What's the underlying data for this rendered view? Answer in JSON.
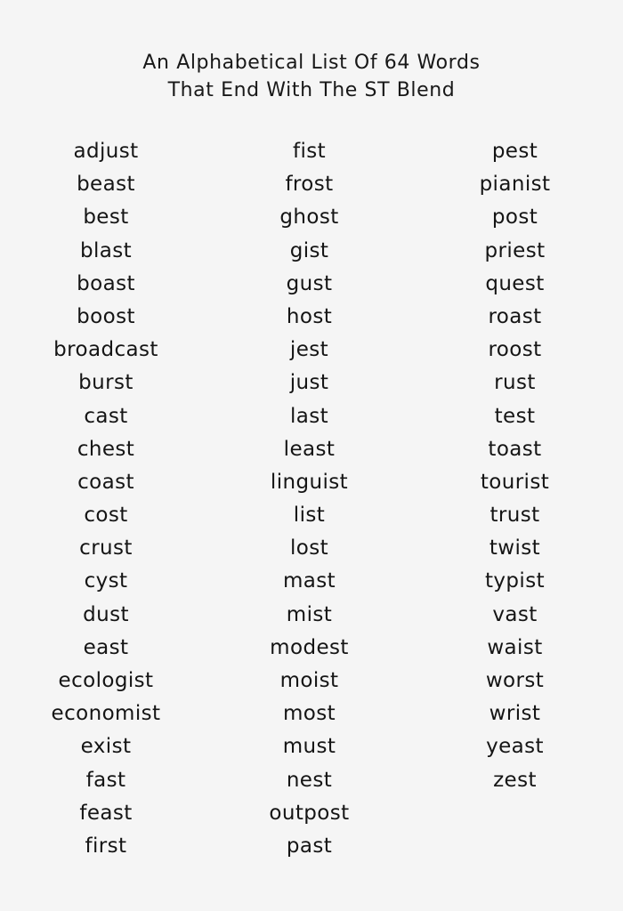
{
  "document": {
    "background_color": "#f5f5f5",
    "text_color": "#151515",
    "title": {
      "line1": "An Alphabetical List Of 64 Words",
      "line2": "That End With The ST Blend"
    },
    "word_count": 64,
    "columns": [
      {
        "id": "column-1",
        "words": [
          "adjust",
          "beast",
          "best",
          "blast",
          "boast",
          "boost",
          "broadcast",
          "burst",
          "cast",
          "chest",
          "coast",
          "cost",
          "crust",
          "cyst",
          "dust",
          "east",
          "ecologist",
          "economist",
          "exist",
          "fast",
          "feast",
          "first"
        ]
      },
      {
        "id": "column-2",
        "words": [
          "fist",
          "frost",
          "ghost",
          "gist",
          "gust",
          "host",
          "jest",
          "just",
          "last",
          "least",
          "linguist",
          "list",
          "lost",
          "mast",
          "mist",
          "modest",
          "moist",
          "most",
          "must",
          "nest",
          "outpost",
          "past"
        ]
      },
      {
        "id": "column-3",
        "words": [
          "pest",
          "pianist",
          "post",
          "priest",
          "quest",
          "roast",
          "roost",
          "rust",
          "test",
          "toast",
          "tourist",
          "trust",
          "twist",
          "typist",
          "vast",
          "waist",
          "worst",
          "wrist",
          "yeast",
          "zest"
        ]
      }
    ]
  }
}
